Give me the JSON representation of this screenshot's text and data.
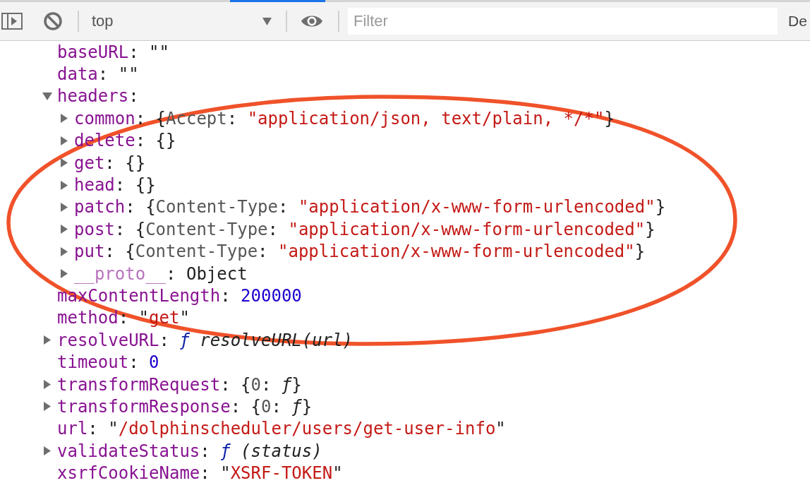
{
  "toolbar": {
    "context_selector": "top",
    "filter": {
      "placeholder": "Filter"
    },
    "levels_dropdown": "De"
  },
  "properties": [
    {
      "expandable": false,
      "dimmed": false,
      "parts": [
        {
          "kind": "key",
          "text": "baseURL"
        },
        {
          "kind": "punct",
          "text": ": \"\""
        }
      ]
    },
    {
      "expandable": false,
      "dimmed": false,
      "parts": [
        {
          "kind": "key",
          "text": "data"
        },
        {
          "kind": "punct",
          "text": ": \"\""
        }
      ]
    },
    {
      "expandable": true,
      "expanded": true,
      "dimmed": false,
      "parts": [
        {
          "kind": "key",
          "text": "headers"
        },
        {
          "kind": "punct",
          "text": ":"
        }
      ],
      "children": [
        {
          "expandable": true,
          "expanded": false,
          "dimmed": false,
          "parts": [
            {
              "kind": "key",
              "text": "common"
            },
            {
              "kind": "punct",
              "text": ": {"
            },
            {
              "kind": "preview_key",
              "text": "Accept"
            },
            {
              "kind": "punct",
              "text": ": "
            },
            {
              "kind": "string",
              "text": "\"application/json, text/plain, */*\""
            },
            {
              "kind": "punct",
              "text": "}"
            }
          ]
        },
        {
          "expandable": true,
          "expanded": false,
          "dimmed": false,
          "parts": [
            {
              "kind": "key",
              "text": "delete"
            },
            {
              "kind": "punct",
              "text": ": {}"
            }
          ]
        },
        {
          "expandable": true,
          "expanded": false,
          "dimmed": false,
          "parts": [
            {
              "kind": "key",
              "text": "get"
            },
            {
              "kind": "punct",
              "text": ": {}"
            }
          ]
        },
        {
          "expandable": true,
          "expanded": false,
          "dimmed": false,
          "parts": [
            {
              "kind": "key",
              "text": "head"
            },
            {
              "kind": "punct",
              "text": ": {}"
            }
          ]
        },
        {
          "expandable": true,
          "expanded": false,
          "dimmed": false,
          "parts": [
            {
              "kind": "key",
              "text": "patch"
            },
            {
              "kind": "punct",
              "text": ": {"
            },
            {
              "kind": "preview_key",
              "text": "Content-Type"
            },
            {
              "kind": "punct",
              "text": ": "
            },
            {
              "kind": "string",
              "text": "\"application/x-www-form-urlencoded\""
            },
            {
              "kind": "punct",
              "text": "}"
            }
          ]
        },
        {
          "expandable": true,
          "expanded": false,
          "dimmed": false,
          "parts": [
            {
              "kind": "key",
              "text": "post"
            },
            {
              "kind": "punct",
              "text": ": {"
            },
            {
              "kind": "preview_key",
              "text": "Content-Type"
            },
            {
              "kind": "punct",
              "text": ": "
            },
            {
              "kind": "string",
              "text": "\"application/x-www-form-urlencoded\""
            },
            {
              "kind": "punct",
              "text": "}"
            }
          ]
        },
        {
          "expandable": true,
          "expanded": false,
          "dimmed": false,
          "parts": [
            {
              "kind": "key",
              "text": "put"
            },
            {
              "kind": "punct",
              "text": ": {"
            },
            {
              "kind": "preview_key",
              "text": "Content-Type"
            },
            {
              "kind": "punct",
              "text": ": "
            },
            {
              "kind": "string",
              "text": "\"application/x-www-form-urlencoded\""
            },
            {
              "kind": "punct",
              "text": "}"
            }
          ]
        },
        {
          "expandable": true,
          "expanded": false,
          "dimmed": true,
          "parts": [
            {
              "kind": "key",
              "text": "__proto__"
            },
            {
              "kind": "punct",
              "text": ": Object"
            }
          ]
        }
      ]
    },
    {
      "expandable": false,
      "dimmed": false,
      "parts": [
        {
          "kind": "key",
          "text": "maxContentLength"
        },
        {
          "kind": "punct",
          "text": ": "
        },
        {
          "kind": "number",
          "text": "200000"
        }
      ]
    },
    {
      "expandable": false,
      "dimmed": false,
      "parts": [
        {
          "kind": "key",
          "text": "method"
        },
        {
          "kind": "punct",
          "text": ": \""
        },
        {
          "kind": "string",
          "text": "get"
        },
        {
          "kind": "punct",
          "text": "\""
        }
      ]
    },
    {
      "expandable": true,
      "expanded": false,
      "dimmed": false,
      "parts": [
        {
          "kind": "key",
          "text": "resolveURL"
        },
        {
          "kind": "punct",
          "text": ": "
        },
        {
          "kind": "func",
          "text": "ƒ"
        },
        {
          "kind": "italic",
          "text": " resolveURL(url)"
        }
      ]
    },
    {
      "expandable": false,
      "dimmed": false,
      "parts": [
        {
          "kind": "key",
          "text": "timeout"
        },
        {
          "kind": "punct",
          "text": ": "
        },
        {
          "kind": "number",
          "text": "0"
        }
      ]
    },
    {
      "expandable": true,
      "expanded": false,
      "dimmed": false,
      "parts": [
        {
          "kind": "key",
          "text": "transformRequest"
        },
        {
          "kind": "punct",
          "text": ": {"
        },
        {
          "kind": "preview_key",
          "text": "0"
        },
        {
          "kind": "punct",
          "text": ": "
        },
        {
          "kind": "italic",
          "text": "ƒ"
        },
        {
          "kind": "punct",
          "text": "}"
        }
      ]
    },
    {
      "expandable": true,
      "expanded": false,
      "dimmed": false,
      "parts": [
        {
          "kind": "key",
          "text": "transformResponse"
        },
        {
          "kind": "punct",
          "text": ": {"
        },
        {
          "kind": "preview_key",
          "text": "0"
        },
        {
          "kind": "punct",
          "text": ": "
        },
        {
          "kind": "italic",
          "text": "ƒ"
        },
        {
          "kind": "punct",
          "text": "}"
        }
      ]
    },
    {
      "expandable": false,
      "dimmed": false,
      "parts": [
        {
          "kind": "key",
          "text": "url"
        },
        {
          "kind": "punct",
          "text": ": \""
        },
        {
          "kind": "string",
          "text": "/dolphinscheduler/users/get-user-info"
        },
        {
          "kind": "punct",
          "text": "\""
        }
      ]
    },
    {
      "expandable": true,
      "expanded": false,
      "dimmed": false,
      "parts": [
        {
          "kind": "key",
          "text": "validateStatus"
        },
        {
          "kind": "punct",
          "text": ": "
        },
        {
          "kind": "func",
          "text": "ƒ"
        },
        {
          "kind": "italic",
          "text": " (status)"
        }
      ]
    },
    {
      "expandable": false,
      "dimmed": false,
      "parts": [
        {
          "kind": "key",
          "text": "xsrfCookieName"
        },
        {
          "kind": "punct",
          "text": ": \""
        },
        {
          "kind": "string",
          "text": "XSRF-TOKEN"
        },
        {
          "kind": "punct",
          "text": "\""
        }
      ]
    }
  ]
}
